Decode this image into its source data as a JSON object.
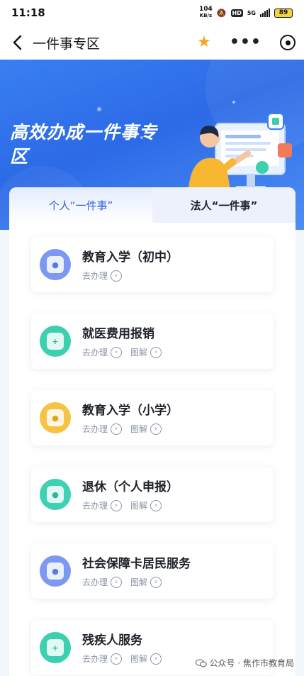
{
  "status_bar": {
    "time": "11:18",
    "net_speed_value": "104",
    "net_speed_unit": "KB/s",
    "hd": "HD",
    "network": "5G",
    "battery": "89"
  },
  "nav": {
    "title": "一件事专区"
  },
  "banner": {
    "title": "高效办成一件事专区"
  },
  "tabs": [
    {
      "label": "个人“一件事”",
      "active": true
    },
    {
      "label": "法人“一件事”",
      "active": false
    }
  ],
  "services": [
    {
      "name": "教育入学（初中）",
      "icon": "education-icon",
      "color": "#6f8ff0",
      "go": "去办理",
      "guide": null
    },
    {
      "name": "就医费用报销",
      "icon": "medical-icon",
      "color": "#3ccfb0",
      "go": "去办理",
      "guide": "图解"
    },
    {
      "name": "教育入学（小学）",
      "icon": "education-icon",
      "color": "#f6c445",
      "go": "去办理",
      "guide": "图解"
    },
    {
      "name": "退休（个人申报）",
      "icon": "retirement-icon",
      "color": "#3fd1b4",
      "go": "去办理",
      "guide": "图解"
    },
    {
      "name": "社会保障卡居民服务",
      "icon": "social-card-icon",
      "color": "#6f8ff0",
      "go": "去办理",
      "guide": "图解"
    },
    {
      "name": "残疾人服务",
      "icon": "disability-icon",
      "color": "#3ccfb0",
      "go": "去办理",
      "guide": "图解"
    }
  ],
  "watermark": {
    "text": "公众号 · 焦作市教育局"
  }
}
